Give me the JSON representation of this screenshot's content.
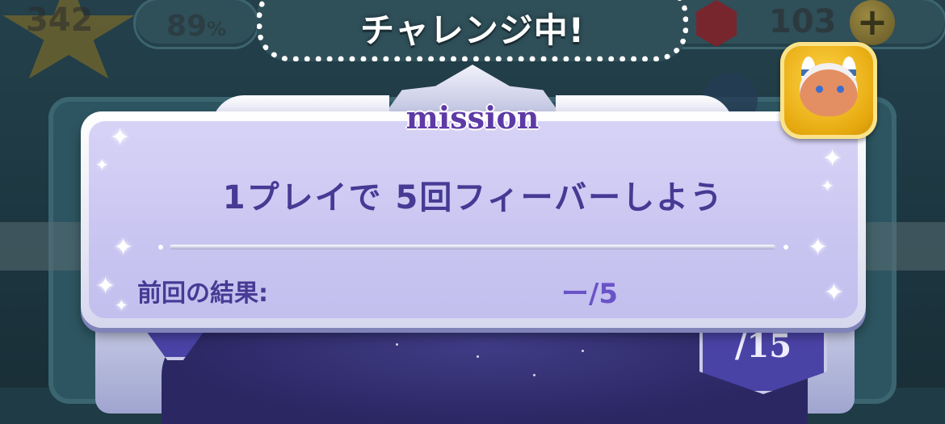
{
  "hud": {
    "stars_count": "342",
    "percent": "89",
    "percent_unit": "%",
    "gem_count": "103",
    "plus_symbol": "+"
  },
  "challenge_banner": {
    "text": "チャレンジ中!"
  },
  "mission_panel": {
    "header": "mission",
    "mission_text": "1プレイで 5回フィーバーしよう",
    "previous_result_label": "前回の結果:",
    "previous_result_value": "ー/5"
  },
  "board": {
    "badge_text": "/15"
  },
  "colors": {
    "mission_text": "#463a94",
    "panel_inner": "#d7d3f6",
    "header_text": "#5e3aa6",
    "badge_gold": "#ffd54a"
  }
}
